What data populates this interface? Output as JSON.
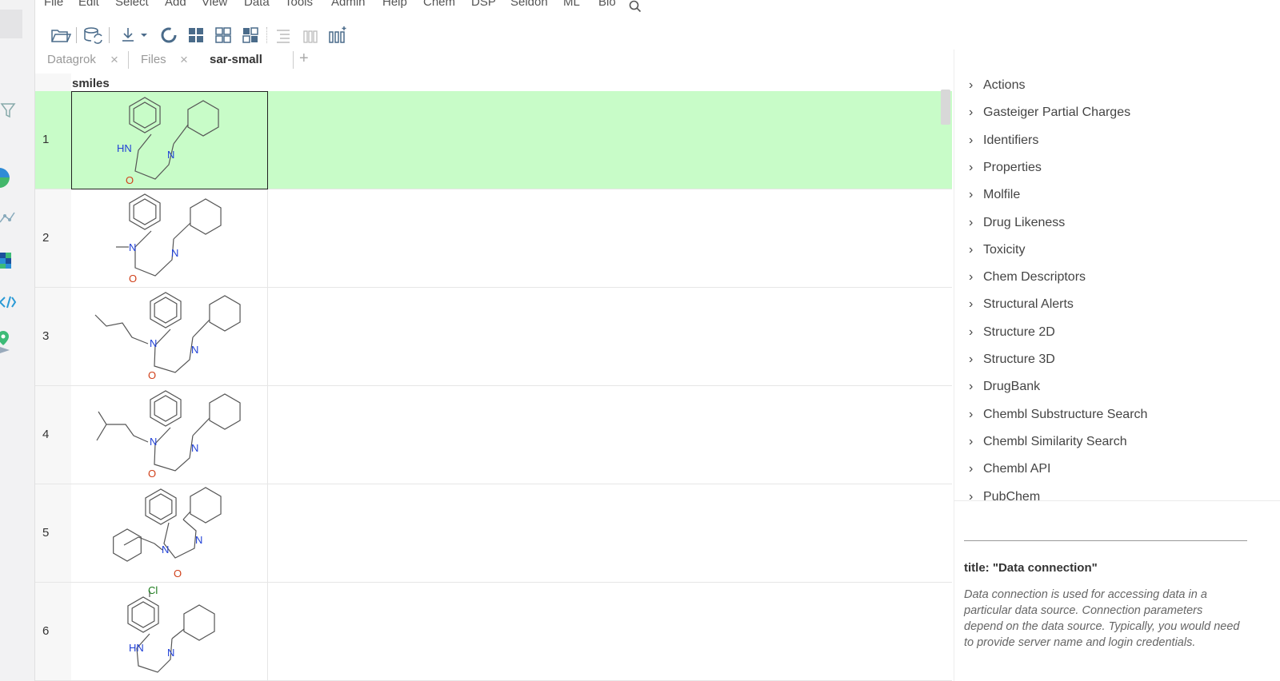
{
  "menu": [
    "File",
    "Edit",
    "Select",
    "Add",
    "View",
    "Data",
    "Tools",
    "Admin",
    "Help",
    "Chem",
    "DSP",
    "Seldon",
    "ML",
    "Bio"
  ],
  "tabs": [
    {
      "label": "Datagrok",
      "close": "×"
    },
    {
      "label": "Files",
      "close": "×"
    },
    {
      "label": "sar-small"
    }
  ],
  "tab_add": "+",
  "grid": {
    "column_header": "smiles",
    "rows": [
      {
        "num": "1",
        "atoms": [
          "HN",
          "N",
          "O"
        ]
      },
      {
        "num": "2",
        "atoms": [
          "N",
          "N",
          "O"
        ]
      },
      {
        "num": "3",
        "atoms": [
          "N",
          "N",
          "O"
        ]
      },
      {
        "num": "4",
        "atoms": [
          "N",
          "N",
          "O"
        ]
      },
      {
        "num": "5",
        "atoms": [
          "N",
          "N",
          "O"
        ]
      },
      {
        "num": "6",
        "atoms": [
          "Cl",
          "HN",
          "N"
        ]
      }
    ]
  },
  "accordion": [
    "Actions",
    "Gasteiger Partial Charges",
    "Identifiers",
    "Properties",
    "Molfile",
    "Drug Likeness",
    "Toxicity",
    "Chem Descriptors",
    "Structural Alerts",
    "Structure 2D",
    "Structure 3D",
    "DrugBank",
    "Chembl Substructure Search",
    "Chembl Similarity Search",
    "Chembl API",
    "PubChem"
  ],
  "help": {
    "title": "title: \"Data connection\"",
    "text": "Data connection is used for accessing data in a particular data source. Connection parameters depend on the data source. Typically, you would need to provide server name and login credentials."
  },
  "colors": {
    "selected_row": "#c8fcc8",
    "nitrogen": "#1f3fd6",
    "oxygen": "#d0401a",
    "chlorine": "#1a7a1a",
    "bond": "#555555"
  }
}
